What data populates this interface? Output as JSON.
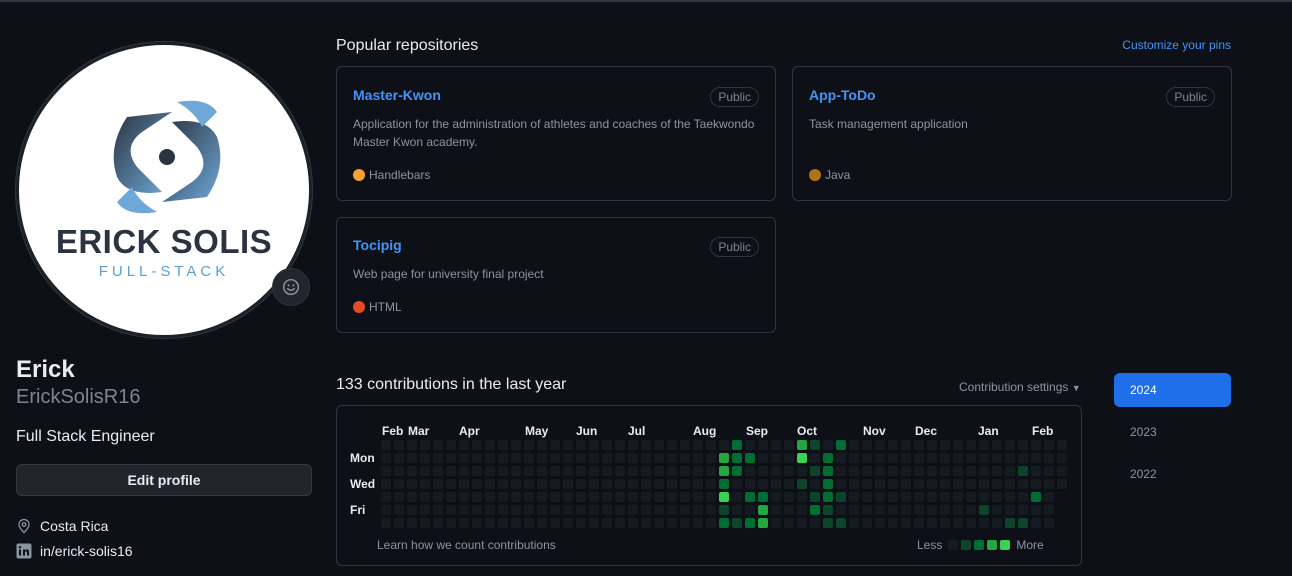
{
  "profile": {
    "avatar_logo_name": "ERICK SOLIS",
    "avatar_logo_sub": "FULL-STACK",
    "name": "Erick",
    "login": "ErickSolisR16",
    "bio": "Full Stack Engineer",
    "edit_label": "Edit profile",
    "location": "Costa Rica",
    "linkedin": "in/erick-solis16"
  },
  "repos": {
    "title": "Popular repositories",
    "customize_label": "Customize your pins",
    "items": [
      {
        "name": "Master-Kwon",
        "visibility": "Public",
        "description": "Application for the administration of athletes and coaches of the Taekwondo Master Kwon academy.",
        "language": "Handlebars",
        "language_color": "#f7a034"
      },
      {
        "name": "App-ToDo",
        "visibility": "Public",
        "description": "Task management application",
        "language": "Java",
        "language_color": "#b07219"
      },
      {
        "name": "Tocipig",
        "visibility": "Public",
        "description": "Web page for university final project",
        "language": "HTML",
        "language_color": "#e34c26"
      }
    ]
  },
  "contributions": {
    "title": "133 contributions in the last year",
    "settings_label": "Contribution settings",
    "months": [
      "Feb",
      "Mar",
      "Apr",
      "May",
      "Jun",
      "Jul",
      "Aug",
      "Sep",
      "Oct",
      "Nov",
      "Dec",
      "Jan",
      "Feb"
    ],
    "day_labels": [
      "Mon",
      "Wed",
      "Fri"
    ],
    "learn_label": "Learn how we count contributions",
    "legend_less": "Less",
    "legend_more": "More",
    "level_colors": [
      "#161b22",
      "#0e4429",
      "#006d32",
      "#26a641",
      "#39d353"
    ]
  },
  "years": [
    "2024",
    "2023",
    "2022"
  ]
}
